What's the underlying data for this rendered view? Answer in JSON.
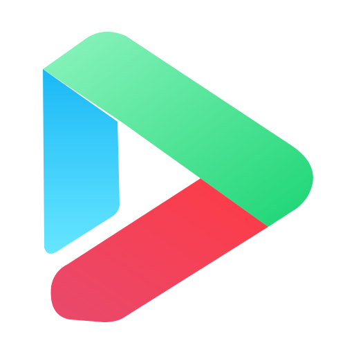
{
  "icon": {
    "name": "play-logo-icon",
    "colors": {
      "background": "#ffffff",
      "blue_top": "#1fc0f8",
      "blue_bottom": "#5ee3ff",
      "green_left": "#86f2b9",
      "green_right": "#1fd777",
      "red_right": "#ff3b47",
      "red_left": "#ea4a6a"
    }
  }
}
